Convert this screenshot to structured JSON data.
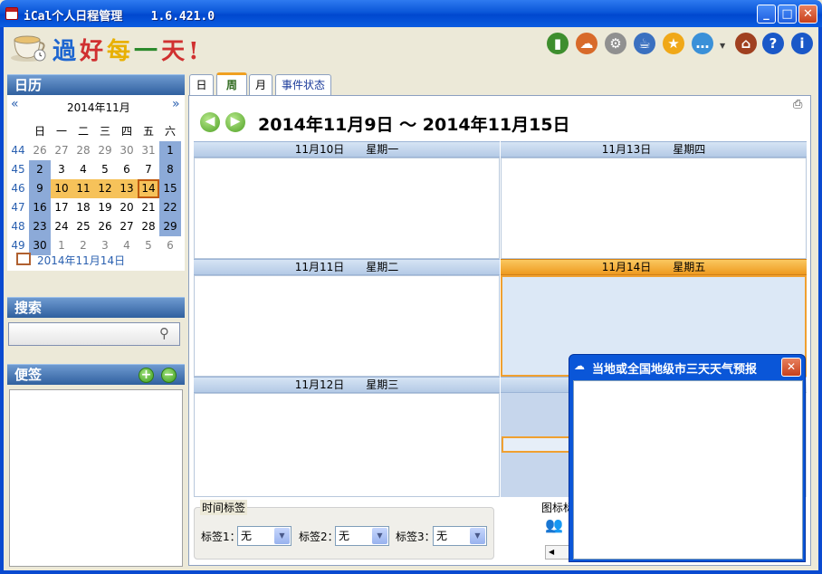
{
  "window": {
    "title": "iCal个人日程管理    1.6.421.0",
    "minimize": "_",
    "maximize": "□",
    "close": "✕"
  },
  "logo": {
    "text": [
      "過",
      "好",
      "每",
      "一",
      "天",
      "!"
    ],
    "colors": [
      "#1E66D0",
      "#D03030",
      "#E8B000",
      "#2C8A2C",
      "#D03030",
      "#D03030"
    ]
  },
  "toolbar": {
    "icons": [
      {
        "name": "book-icon",
        "glyph": "▮",
        "color": "#3E8E2E"
      },
      {
        "name": "weather-icon",
        "glyph": "☁",
        "color": "#D86A2A"
      },
      {
        "name": "gear-icon",
        "glyph": "⚙",
        "color": "#909090"
      },
      {
        "name": "teapot-icon",
        "glyph": "☕",
        "color": "#3A70C0"
      },
      {
        "name": "star-icon",
        "glyph": "★",
        "color": "#F0A818"
      },
      {
        "name": "chat-icon",
        "glyph": "…",
        "color": "#3A90D8"
      },
      {
        "name": "home-icon",
        "glyph": "⌂",
        "color": "#A04020"
      },
      {
        "name": "help-icon",
        "glyph": "?",
        "color": "#1A58C8"
      },
      {
        "name": "info-icon",
        "glyph": "i",
        "color": "#1A58C8"
      }
    ]
  },
  "calendar_panel": {
    "title": "日历",
    "month_label": "2014年11月",
    "prev": "«",
    "next": "»",
    "weekdays": [
      "日",
      "一",
      "二",
      "三",
      "四",
      "五",
      "六"
    ],
    "weeks": [
      {
        "wk": "44",
        "days": [
          "26",
          "27",
          "28",
          "29",
          "30",
          "31",
          "1"
        ]
      },
      {
        "wk": "45",
        "days": [
          "2",
          "3",
          "4",
          "5",
          "6",
          "7",
          "8"
        ]
      },
      {
        "wk": "46",
        "days": [
          "9",
          "10",
          "11",
          "12",
          "13",
          "14",
          "15"
        ]
      },
      {
        "wk": "47",
        "days": [
          "16",
          "17",
          "18",
          "19",
          "20",
          "21",
          "22"
        ]
      },
      {
        "wk": "48",
        "days": [
          "23",
          "24",
          "25",
          "26",
          "27",
          "28",
          "29"
        ]
      },
      {
        "wk": "49",
        "days": [
          "30",
          "1",
          "2",
          "3",
          "4",
          "5",
          "6"
        ]
      }
    ],
    "today_label": "2014年11月14日"
  },
  "search_panel": {
    "title": "搜索",
    "placeholder": ""
  },
  "notes_panel": {
    "title": "便签",
    "add": "+",
    "remove": "−"
  },
  "tabs": [
    {
      "label": "日"
    },
    {
      "label": "周"
    },
    {
      "label": "月"
    },
    {
      "label": "事件状态"
    }
  ],
  "week_view": {
    "range_title": "2014年11月9日 ～ 2014年11月15日",
    "days": [
      {
        "date": "11月10日",
        "weekday": "星期一"
      },
      {
        "date": "11月11日",
        "weekday": "星期二"
      },
      {
        "date": "11月12日",
        "weekday": "星期三"
      },
      {
        "date": "11月13日",
        "weekday": "星期四"
      },
      {
        "date": "11月14日",
        "weekday": "星期五"
      }
    ]
  },
  "time_tags": {
    "group_title": "时间标签",
    "tags": [
      {
        "label": "标签1：",
        "value": "无"
      },
      {
        "label": "标签2：",
        "value": "无"
      },
      {
        "label": "标签3：",
        "value": "无"
      }
    ]
  },
  "icon_tags": {
    "group_title": "图标标"
  },
  "weather_popup": {
    "title": "当地或全国地级市三天天气预报",
    "close": "✕"
  }
}
